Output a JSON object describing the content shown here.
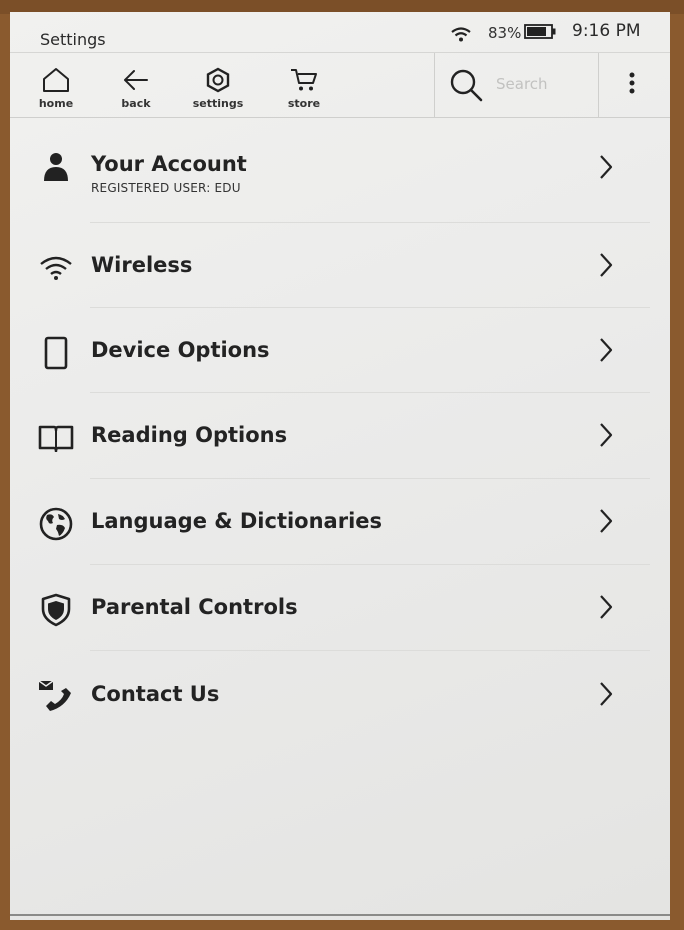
{
  "status_bar": {
    "title": "Settings",
    "battery_percent": "83%",
    "time": "9:16 PM"
  },
  "toolbar": {
    "home_label": "home",
    "back_label": "back",
    "settings_label": "settings",
    "store_label": "store",
    "search_placeholder": "Search"
  },
  "menu": {
    "items": [
      {
        "label": "Your Account",
        "sublabel": "REGISTERED USER: EDU",
        "icon": "person-icon"
      },
      {
        "label": "Wireless",
        "icon": "wifi-icon"
      },
      {
        "label": "Device Options",
        "icon": "device-icon"
      },
      {
        "label": "Reading Options",
        "icon": "open-book-icon"
      },
      {
        "label": "Language & Dictionaries",
        "icon": "globe-icon"
      },
      {
        "label": "Parental Controls",
        "icon": "shield-icon"
      },
      {
        "label": "Contact Us",
        "icon": "contact-icon"
      }
    ]
  }
}
